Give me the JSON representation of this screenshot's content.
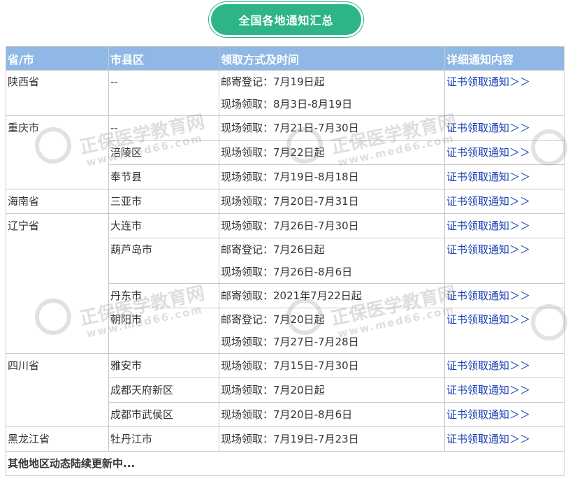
{
  "title": "全国各地通知汇总",
  "headers": [
    "省/市",
    "市县区",
    "领取方式及时间",
    "详细通知内容"
  ],
  "rows": [
    {
      "province": "陕西省",
      "city": "--",
      "methods": [
        "邮寄登记：7月19日起",
        "现场领取：8月3日-8月19日"
      ],
      "link": "证书领取通知＞＞"
    },
    {
      "province": "重庆市",
      "city": "--",
      "methods": [
        "现场领取：7月21日-7月30日"
      ],
      "link": "证书领取通知＞＞"
    },
    {
      "province": "",
      "city": "涪陵区",
      "methods": [
        "现场领取：7月22日起"
      ],
      "link": "证书领取通知＞＞"
    },
    {
      "province": "",
      "city": "奉节县",
      "methods": [
        "现场领取：7月19日-8月18日"
      ],
      "link": "证书领取通知＞＞"
    },
    {
      "province": "海南省",
      "city": "三亚市",
      "methods": [
        "现场领取：7月20日-7月31日"
      ],
      "link": "证书领取通知＞＞"
    },
    {
      "province": "辽宁省",
      "city": "大连市",
      "methods": [
        "现场领取：7月26日-7月30日"
      ],
      "link": "证书领取通知＞＞"
    },
    {
      "province": "",
      "city": "葫芦岛市",
      "methods": [
        "邮寄登记：7月26日起",
        "现场领取：7月26日-8月6日"
      ],
      "link": "证书领取通知＞＞"
    },
    {
      "province": "",
      "city": "丹东市",
      "methods": [
        "邮寄领取：2021年7月22日起"
      ],
      "link": "证书领取通知＞＞"
    },
    {
      "province": "",
      "city": "朝阳市",
      "methods": [
        "邮寄登记：7月20日起",
        "现场领取：7月27日-7月28日"
      ],
      "link": "证书领取通知＞＞"
    },
    {
      "province": "四川省",
      "city": "雅安市",
      "methods": [
        "现场领取：7月15日-7月30日"
      ],
      "link": "证书领取通知＞＞"
    },
    {
      "province": "",
      "city": "成都天府新区",
      "methods": [
        "现场领取：7月20日起"
      ],
      "link": "证书领取通知＞＞"
    },
    {
      "province": "",
      "city": "成都市武侯区",
      "methods": [
        "现场领取：7月20日-8月6日"
      ],
      "link": "证书领取通知＞＞"
    },
    {
      "province": "黑龙江省",
      "city": "牡丹江市",
      "methods": [
        "现场领取：7月19日-7月23日"
      ],
      "link": "证书领取通知＞＞"
    }
  ],
  "footer": "其他地区动态陆续更新中...",
  "watermark": {
    "name": "正保医学教育网",
    "url": "www.med66.com"
  },
  "colors": {
    "title_bg": "#2eb585",
    "header_bg": "#8fb8e6",
    "link": "#1a3fb3"
  }
}
